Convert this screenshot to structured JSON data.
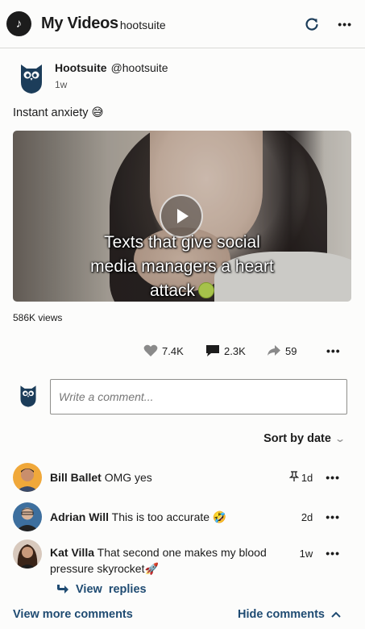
{
  "header": {
    "title": "My Videos",
    "subtitle": "hootsuite",
    "refresh_icon": "refresh-icon",
    "more_icon": "more-horizontal-icon"
  },
  "post": {
    "author_name": "Hootsuite",
    "author_handle": "@hootsuite",
    "time": "1w",
    "caption": "Instant anxiety 😅",
    "video_overlay": {
      "line1": "Texts that give social",
      "line2": "media managers a heart",
      "line3": "attack"
    },
    "views": "586K views",
    "likes": "7.4K",
    "comments": "2.3K",
    "shares": "59"
  },
  "composer": {
    "placeholder": "Write a comment..."
  },
  "sort": {
    "label": "Sort by date"
  },
  "comments": [
    {
      "name": "Bill Ballet",
      "text": "OMG yes",
      "time": "1d",
      "pinned": true
    },
    {
      "name": "Adrian Will",
      "text": "This is too accurate 🤣",
      "time": "2d",
      "pinned": false
    },
    {
      "name": "Kat Villa",
      "text": "That second one makes my blood pressure skyrocket🚀",
      "time": "1w",
      "pinned": false
    }
  ],
  "links": {
    "view_replies": "View  replies",
    "view_more": "View more comments",
    "hide_comments": "Hide comments"
  },
  "colors": {
    "link": "#1f4b72",
    "owl_navy": "#1c3d5a",
    "text": "#1c1c1c"
  }
}
